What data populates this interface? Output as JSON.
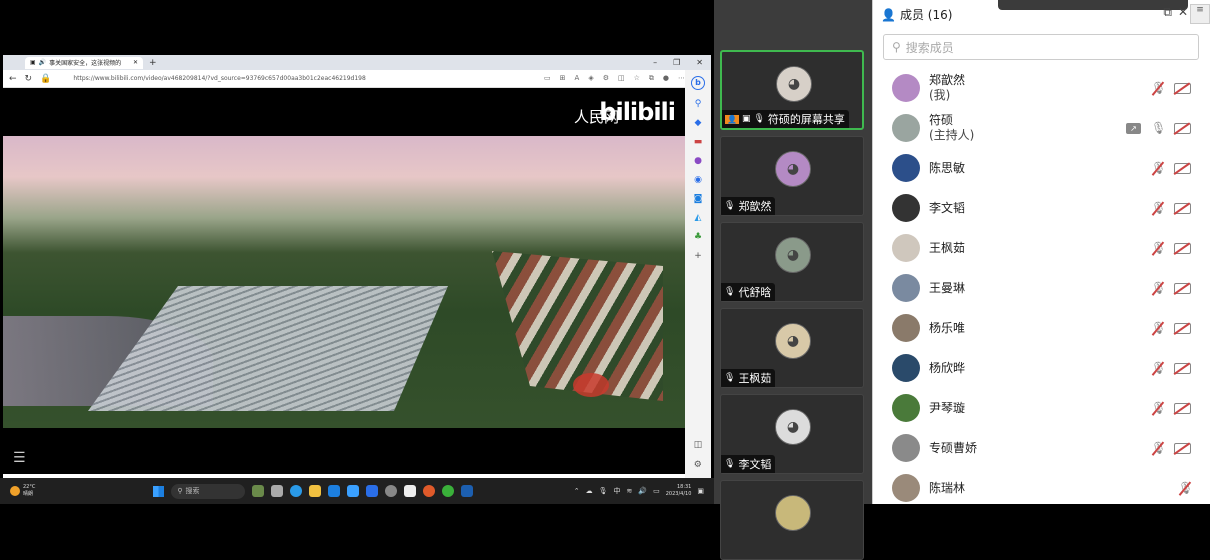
{
  "browser": {
    "tab_title": "事关国家安全，这张视频的",
    "url_host": "https://www.bilibili.com",
    "url_path": "/video/av468209814/?vd_source=93769c657d00aa3b01c2eac46219d198"
  },
  "video": {
    "logo_rmw": "人民网",
    "logo_bili": "bilibili"
  },
  "taskbar": {
    "weather_temp": "22°C",
    "weather_desc": "晴朗",
    "search": "搜索",
    "ime": "中",
    "time": "18:31",
    "date": "2023/4/10"
  },
  "tiles": [
    {
      "name": "符硕的屏幕共享",
      "active": true
    },
    {
      "name": "郑歆然"
    },
    {
      "name": "代舒晗"
    },
    {
      "name": "王枫茹"
    },
    {
      "name": "李文韬"
    }
  ],
  "panel": {
    "title": "成员 (16)",
    "search_placeholder": "搜索成员",
    "members": [
      {
        "name": "郑歆然",
        "sub": "(我)",
        "color": "#b48ac4"
      },
      {
        "name": "符硕",
        "sub": "(主持人)",
        "color": "#9aa5a0",
        "sharing": true,
        "mic_on": true
      },
      {
        "name": "陈思敏",
        "color": "#2c4f8a"
      },
      {
        "name": "李文韬",
        "color": "#333333"
      },
      {
        "name": "王枫茹",
        "color": "#cfc7bd"
      },
      {
        "name": "王曼琳",
        "color": "#7a8aa0"
      },
      {
        "name": "杨乐唯",
        "color": "#8a7a6a"
      },
      {
        "name": "杨欣晔",
        "color": "#2a4a6a"
      },
      {
        "name": "尹琴璇",
        "color": "#4a7a3a"
      },
      {
        "name": "专硕曹娇",
        "color": "#8a8a8a"
      },
      {
        "name": "陈瑞林",
        "color": "#9a8a7a",
        "cam_hidden": true
      }
    ]
  }
}
